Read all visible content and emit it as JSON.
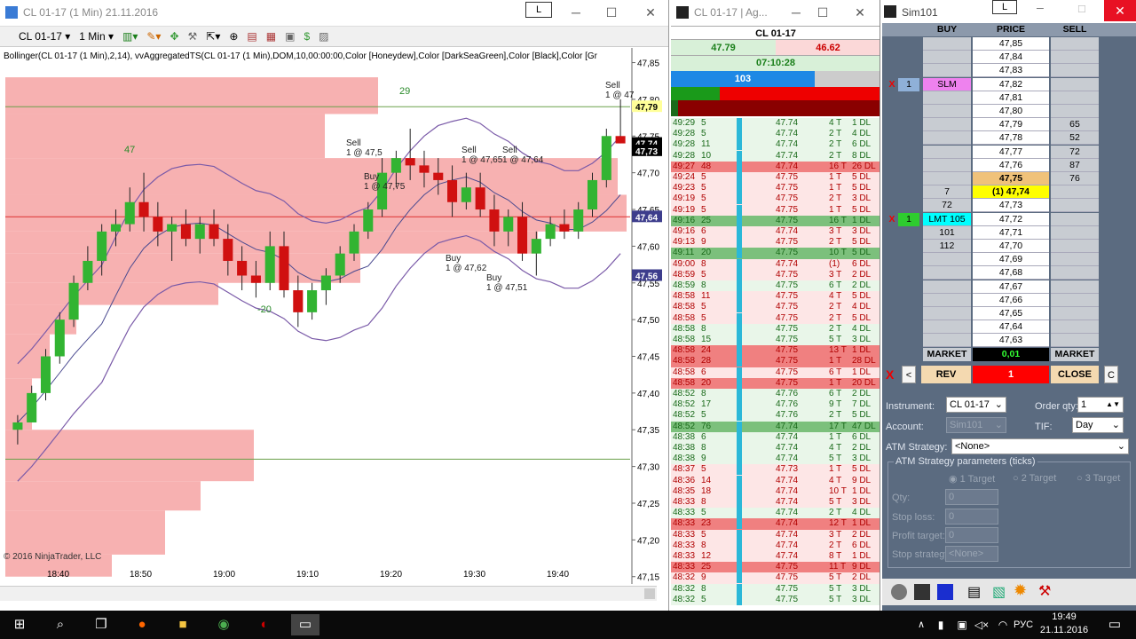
{
  "chart_window": {
    "title": "CL 01-17 (1 Min)  21.11.2016",
    "instrument": "CL 01-17",
    "period": "1 Min",
    "indicator_label": "Bollinger(CL 01-17 (1 Min),2,14), vvAggregatedTS(CL 01-17 (1 Min),DOM,10,00:00:00,Color [Honeydew],Color [DarkSeaGreen],Color [Black],Color [Gr",
    "copyright": "© 2016 NinjaTrader, LLC",
    "l_button": "L"
  },
  "chart_data": {
    "type": "candlestick",
    "x_ticks": [
      "18:40",
      "18:50",
      "19:00",
      "19:10",
      "19:20",
      "19:30",
      "19:40"
    ],
    "y_ticks": [
      "47,85",
      "47,80",
      "47,75",
      "47,70",
      "47,65",
      "47,60",
      "47,55",
      "47,50",
      "47,45",
      "47,40",
      "47,35",
      "47,30",
      "47,25",
      "47,20",
      "47,15"
    ],
    "price_badges": [
      {
        "text": "47,79",
        "color": "#ffff99",
        "fg": "#000"
      },
      {
        "text": "47,74",
        "color": "#000000",
        "fg": "#fff"
      },
      {
        "text": "47,73",
        "color": "#000000",
        "fg": "#fff"
      },
      {
        "text": "47,64",
        "color": "#3d3d8c",
        "fg": "#fff"
      },
      {
        "text": "47,56",
        "color": "#3d3d8c",
        "fg": "#fff"
      }
    ],
    "zigzag_labels": [
      "47",
      "29",
      "-20"
    ],
    "trade_markers": [
      "Sell\n1 @ 47,5",
      "Buy\n1 @ 47,75",
      "Sell\n1 @ 47,65",
      "Buy\n1 @ 47,62",
      "Sell\n1 @ 47,64",
      "Buy\n1 @ 47,51",
      "Sell\n1 @ 47"
    ],
    "candles": [
      [
        47.35,
        47.37,
        47.33,
        47.36
      ],
      [
        47.36,
        47.41,
        47.36,
        47.4
      ],
      [
        47.4,
        47.46,
        47.39,
        47.45
      ],
      [
        47.45,
        47.51,
        47.44,
        47.5
      ],
      [
        47.5,
        47.56,
        47.49,
        47.55
      ],
      [
        47.55,
        47.6,
        47.54,
        47.58
      ],
      [
        47.58,
        47.63,
        47.56,
        47.62
      ],
      [
        47.62,
        47.65,
        47.6,
        47.63
      ],
      [
        47.63,
        47.68,
        47.62,
        47.66
      ],
      [
        47.66,
        47.7,
        47.62,
        47.64
      ],
      [
        47.64,
        47.66,
        47.6,
        47.62
      ],
      [
        47.62,
        47.64,
        47.58,
        47.63
      ],
      [
        47.63,
        47.65,
        47.6,
        47.61
      ],
      [
        47.61,
        47.64,
        47.59,
        47.63
      ],
      [
        47.63,
        47.65,
        47.6,
        47.61
      ],
      [
        47.61,
        47.63,
        47.56,
        47.58
      ],
      [
        47.58,
        47.6,
        47.54,
        47.56
      ],
      [
        47.56,
        47.58,
        47.53,
        47.55
      ],
      [
        47.55,
        47.62,
        47.54,
        47.6
      ],
      [
        47.6,
        47.62,
        47.53,
        47.54
      ],
      [
        47.54,
        47.56,
        47.49,
        47.51
      ],
      [
        47.51,
        47.55,
        47.5,
        47.54
      ],
      [
        47.54,
        47.57,
        47.52,
        47.56
      ],
      [
        47.56,
        47.6,
        47.55,
        47.59
      ],
      [
        47.59,
        47.63,
        47.58,
        47.62
      ],
      [
        47.62,
        47.66,
        47.61,
        47.65
      ],
      [
        47.65,
        47.72,
        47.64,
        47.7
      ],
      [
        47.7,
        47.73,
        47.68,
        47.72
      ],
      [
        47.72,
        47.76,
        47.69,
        47.71
      ],
      [
        47.71,
        47.73,
        47.68,
        47.7
      ],
      [
        47.7,
        47.72,
        47.67,
        47.69
      ],
      [
        47.69,
        47.71,
        47.64,
        47.66
      ],
      [
        47.66,
        47.7,
        47.65,
        47.68
      ],
      [
        47.68,
        47.7,
        47.64,
        47.65
      ],
      [
        47.65,
        47.67,
        47.6,
        47.62
      ],
      [
        47.62,
        47.65,
        47.6,
        47.64
      ],
      [
        47.64,
        47.66,
        47.58,
        47.59
      ],
      [
        47.59,
        47.62,
        47.56,
        47.61
      ],
      [
        47.61,
        47.64,
        47.6,
        47.63
      ],
      [
        47.63,
        47.65,
        47.61,
        47.62
      ],
      [
        47.62,
        47.66,
        47.61,
        47.65
      ],
      [
        47.65,
        47.7,
        47.64,
        47.69
      ],
      [
        47.69,
        47.76,
        47.68,
        47.75
      ],
      [
        47.75,
        47.8,
        47.74,
        47.74
      ]
    ],
    "ylim": [
      47.14,
      47.87
    ]
  },
  "ladder_window": {
    "title": "CL 01-17 | Ag...",
    "instrument": "CL 01-17",
    "bid": "47.79",
    "ask": "46.62",
    "time": "07:10:28",
    "volume_bar": "103"
  },
  "tape": [
    [
      "49:29",
      "5",
      "47.74",
      "4 T",
      "1 DL",
      "g"
    ],
    [
      "49:28",
      "5",
      "47.74",
      "2 T",
      "4 DL",
      "g"
    ],
    [
      "49:28",
      "11",
      "47.74",
      "2 T",
      "6 DL",
      "g"
    ],
    [
      "49:28",
      "10",
      "47.74",
      "2 T",
      "8 DL",
      "g"
    ],
    [
      "49:27",
      "48",
      "47.74",
      "16 T",
      "26 DL",
      "R"
    ],
    [
      "49:24",
      "5",
      "47.75",
      "1 T",
      "5 DL",
      "r"
    ],
    [
      "49:23",
      "5",
      "47.75",
      "1 T",
      "5 DL",
      "r"
    ],
    [
      "49:19",
      "5",
      "47.75",
      "2 T",
      "3 DL",
      "r"
    ],
    [
      "49:19",
      "5",
      "47.75",
      "1 T",
      "5 DL",
      "r"
    ],
    [
      "49:16",
      "25",
      "47.75",
      "16 T",
      "1 DL",
      "G"
    ],
    [
      "49:16",
      "6",
      "47.74",
      "3 T",
      "3 DL",
      "r"
    ],
    [
      "49:13",
      "9",
      "47.75",
      "2 T",
      "5 DL",
      "r"
    ],
    [
      "49:11",
      "20",
      "47.75",
      "10 T",
      "5 DL",
      "G"
    ],
    [
      "49:00",
      "8",
      "47.74",
      "(1)",
      "6 DL",
      "r"
    ],
    [
      "48:59",
      "5",
      "47.75",
      "3 T",
      "2 DL",
      "r"
    ],
    [
      "48:59",
      "8",
      "47.75",
      "6 T",
      "2 DL",
      "g"
    ],
    [
      "48:58",
      "11",
      "47.75",
      "4 T",
      "5 DL",
      "r"
    ],
    [
      "48:58",
      "5",
      "47.75",
      "2 T",
      "4 DL",
      "r"
    ],
    [
      "48:58",
      "5",
      "47.75",
      "2 T",
      "5 DL",
      "r"
    ],
    [
      "48:58",
      "8",
      "47.75",
      "2 T",
      "4 DL",
      "g"
    ],
    [
      "48:58",
      "15",
      "47.75",
      "5 T",
      "3 DL",
      "g"
    ],
    [
      "48:58",
      "24",
      "47.75",
      "13 T",
      "1 DL",
      "R"
    ],
    [
      "48:58",
      "28",
      "47.75",
      "1 T",
      "28 DL",
      "R"
    ],
    [
      "48:58",
      "6",
      "47.75",
      "6 T",
      "1 DL",
      "r"
    ],
    [
      "48:58",
      "20",
      "47.75",
      "1 T",
      "20 DL",
      "R"
    ],
    [
      "48:52",
      "8",
      "47.76",
      "6 T",
      "2 DL",
      "g"
    ],
    [
      "48:52",
      "17",
      "47.76",
      "9 T",
      "7 DL",
      "g"
    ],
    [
      "48:52",
      "5",
      "47.76",
      "2 T",
      "5 DL",
      "g"
    ],
    [
      "48:52",
      "76",
      "47.74",
      "17 T",
      "47 DL",
      "G"
    ],
    [
      "48:38",
      "6",
      "47.74",
      "1 T",
      "6 DL",
      "g"
    ],
    [
      "48:38",
      "8",
      "47.74",
      "4 T",
      "2 DL",
      "g"
    ],
    [
      "48:38",
      "9",
      "47.74",
      "5 T",
      "3 DL",
      "g"
    ],
    [
      "48:37",
      "5",
      "47.73",
      "1 T",
      "5 DL",
      "r"
    ],
    [
      "48:36",
      "14",
      "47.74",
      "4 T",
      "9 DL",
      "r"
    ],
    [
      "48:35",
      "18",
      "47.74",
      "10 T",
      "1 DL",
      "r"
    ],
    [
      "48:33",
      "8",
      "47.74",
      "5 T",
      "3 DL",
      "r"
    ],
    [
      "48:33",
      "5",
      "47.74",
      "2 T",
      "4 DL",
      "g"
    ],
    [
      "48:33",
      "23",
      "47.74",
      "12 T",
      "1 DL",
      "R"
    ],
    [
      "48:33",
      "5",
      "47.74",
      "3 T",
      "2 DL",
      "r"
    ],
    [
      "48:33",
      "8",
      "47.74",
      "2 T",
      "6 DL",
      "r"
    ],
    [
      "48:33",
      "12",
      "47.74",
      "8 T",
      "1 DL",
      "r"
    ],
    [
      "48:33",
      "25",
      "47.75",
      "11 T",
      "9 DL",
      "R"
    ],
    [
      "48:32",
      "9",
      "47.75",
      "5 T",
      "2 DL",
      "r"
    ],
    [
      "48:32",
      "8",
      "47.75",
      "5 T",
      "3 DL",
      "g"
    ],
    [
      "48:32",
      "5",
      "47.75",
      "5 T",
      "3 DL",
      "g"
    ]
  ],
  "order_window": {
    "title": "Sim101",
    "l_button": "L",
    "headers": {
      "buy": "BUY",
      "price": "PRICE",
      "sell": "SELL"
    },
    "rows": [
      {
        "buy": "",
        "price": "47,85",
        "sell": ""
      },
      {
        "buy": "",
        "price": "47,84",
        "sell": ""
      },
      {
        "buy": "",
        "price": "47,83",
        "sell": ""
      },
      {
        "x": "X",
        "qty": "1",
        "buy": "SLM",
        "price": "47,82",
        "sell": ""
      },
      {
        "buy": "",
        "price": "47,81",
        "sell": ""
      },
      {
        "buy": "",
        "price": "47,80",
        "sell": ""
      },
      {
        "buy": "",
        "price": "47,79",
        "sell": "65"
      },
      {
        "buy": "",
        "price": "47,78",
        "sell": "52"
      },
      {
        "buy": "",
        "price": "47,77",
        "sell": "72"
      },
      {
        "buy": "",
        "price": "47,76",
        "sell": "87"
      },
      {
        "buy": "",
        "price": "47,75",
        "sell": "76"
      },
      {
        "buy": "7",
        "price": "(1) 47,74",
        "sell": ""
      },
      {
        "buy": "72",
        "price": "47,73",
        "sell": ""
      },
      {
        "x": "X",
        "qty": "1",
        "buy": "LMT 105",
        "price": "47,72",
        "sell": ""
      },
      {
        "buy": "101",
        "price": "47,71",
        "sell": ""
      },
      {
        "buy": "112",
        "price": "47,70",
        "sell": ""
      },
      {
        "buy": "",
        "price": "47,69",
        "sell": ""
      },
      {
        "buy": "",
        "price": "47,68",
        "sell": ""
      },
      {
        "buy": "",
        "price": "47,67",
        "sell": ""
      },
      {
        "buy": "",
        "price": "47,66",
        "sell": ""
      },
      {
        "buy": "",
        "price": "47,65",
        "sell": ""
      },
      {
        "buy": "",
        "price": "47,64",
        "sell": ""
      },
      {
        "buy": "",
        "price": "47,63",
        "sell": ""
      }
    ],
    "market_buy": "MARKET",
    "pnl": "0,01",
    "market_sell": "MARKET",
    "x": "X",
    "left": "<",
    "rev": "REV",
    "qty": "1",
    "close": "CLOSE",
    "c": "C",
    "instrument_label": "Instrument:",
    "instrument": "CL 01-17",
    "order_qty_label": "Order qty:",
    "order_qty": "1",
    "account_label": "Account:",
    "account": "Sim101",
    "tif_label": "TIF:",
    "tif": "Day",
    "atm_label": "ATM Strategy:",
    "atm": "<None>",
    "atm_params": "ATM Strategy parameters (ticks)",
    "t1": "1 Target",
    "t2": "2 Target",
    "t3": "3 Target",
    "qty_label": "Qty:",
    "qty_val": "0",
    "stop_label": "Stop loss:",
    "stop_val": "0",
    "profit_label": "Profit target:",
    "profit_val": "0",
    "stopstrat_label": "Stop strategy:",
    "stopstrat_val": "<None>"
  },
  "taskbar": {
    "lang": "РУС",
    "time": "19:49",
    "date": "21.11.2016"
  }
}
